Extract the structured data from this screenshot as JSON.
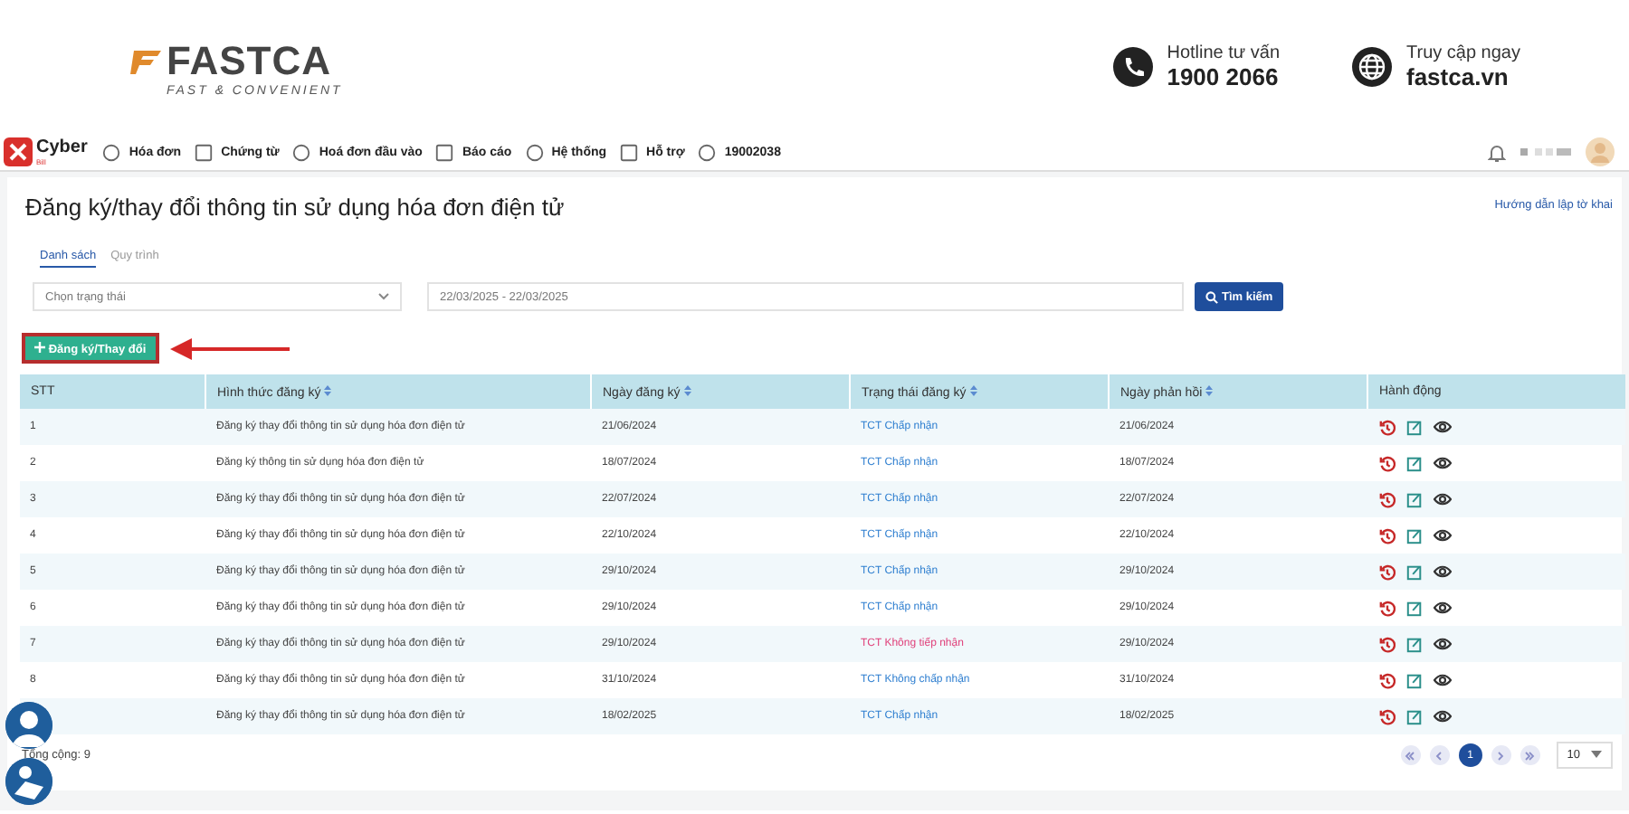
{
  "banner": {
    "brand": "FASTCA",
    "slogan": "FAST & CONVENIENT",
    "hotline_label": "Hotline tư vấn",
    "hotline": "1900 2066",
    "web_label": "Truy cập ngay",
    "web": "fastca.vn"
  },
  "nav": {
    "logo": "Cyber",
    "logo_sub": "Bill",
    "items": [
      "Hóa đơn",
      "Chứng từ",
      "Hoá đơn đầu vào",
      "Báo cáo",
      "Hệ thống",
      "Hỗ trợ",
      "19002038"
    ]
  },
  "page": {
    "title": "Đăng ký/thay đổi thông tin sử dụng hóa đơn điện tử",
    "guide_link": "Hướng dẫn lập tờ khai",
    "tabs": [
      {
        "label": "Danh sách",
        "selected": true
      },
      {
        "label": "Quy trình",
        "selected": false
      }
    ],
    "status_select": {
      "placeholder": "Chọn trạng thái"
    },
    "date_range": {
      "value": "22/03/2025 - 22/03/2025"
    },
    "search_button": "Tìm kiếm",
    "add_button": "Đăng ký/Thay đổi"
  },
  "table": {
    "columns": [
      "STT",
      "Hình thức đăng ký",
      "Ngày đăng ký",
      "Trạng thái đăng ký",
      "Ngày phản hồi",
      "Hành động"
    ],
    "rows": [
      {
        "stt": "1",
        "type": "Đăng ký thay đổi thông tin sử dụng hóa đơn điện tử",
        "registered": "21/06/2024",
        "status": "TCT Chấp nhận",
        "color": "#2f7fd0",
        "replied": "21/06/2024"
      },
      {
        "stt": "2",
        "type": "Đăng ký thông tin sử dụng hóa đơn điện tử",
        "registered": "18/07/2024",
        "status": "TCT Chấp nhận",
        "color": "#2f7fd0",
        "replied": "18/07/2024"
      },
      {
        "stt": "3",
        "type": "Đăng ký thay đổi thông tin sử dụng hóa đơn điện tử",
        "registered": "22/07/2024",
        "status": "TCT Chấp nhận",
        "color": "#2f7fd0",
        "replied": "22/07/2024"
      },
      {
        "stt": "4",
        "type": "Đăng ký thay đổi thông tin sử dụng hóa đơn điện tử",
        "registered": "22/10/2024",
        "status": "TCT Chấp nhận",
        "color": "#2f7fd0",
        "replied": "22/10/2024"
      },
      {
        "stt": "5",
        "type": "Đăng ký thay đổi thông tin sử dụng hóa đơn điện tử",
        "registered": "29/10/2024",
        "status": "TCT Chấp nhận",
        "color": "#2f7fd0",
        "replied": "29/10/2024"
      },
      {
        "stt": "6",
        "type": "Đăng ký thay đổi thông tin sử dụng hóa đơn điện tử",
        "registered": "29/10/2024",
        "status": "TCT Chấp nhận",
        "color": "#2f7fd0",
        "replied": "29/10/2024"
      },
      {
        "stt": "7",
        "type": "Đăng ký thay đổi thông tin sử dụng hóa đơn điện tử",
        "registered": "29/10/2024",
        "status": "TCT Không tiếp nhận",
        "color": "#e0407a",
        "replied": "29/10/2024"
      },
      {
        "stt": "8",
        "type": "Đăng ký thay đổi thông tin sử dụng hóa đơn điện tử",
        "registered": "31/10/2024",
        "status": "TCT Không chấp nhận",
        "color": "#2f7fd0",
        "replied": "31/10/2024"
      },
      {
        "type": "Đăng ký thay đổi thông tin sử dụng hóa đơn điện tử",
        "registered": "18/02/2025",
        "status": "TCT Chấp nhận",
        "color": "#2f7fd0",
        "replied": "18/02/2025"
      }
    ]
  },
  "footer": {
    "total": "Tổng cộng: 9",
    "pages": [
      {
        "label": "1",
        "selected": true
      }
    ],
    "page_size": "10"
  }
}
